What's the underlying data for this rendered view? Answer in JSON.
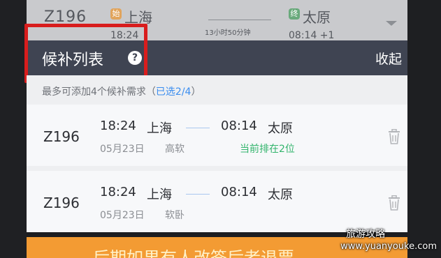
{
  "background_row": {
    "train": "Z196",
    "from_station": "上海",
    "to_station": "太原",
    "depart_time": "18:24",
    "arrive_time": "08:14 +1",
    "duration": "13小时50分钟"
  },
  "header": {
    "title": "候补列表",
    "help_icon": "?",
    "collapse_label": "收起"
  },
  "hint": {
    "prefix": "最多可添加4个候补需求（",
    "selected": "已选2/4",
    "suffix": "）"
  },
  "items": [
    {
      "train": "Z196",
      "depart_time": "18:24",
      "from_station": "上海",
      "arrive_time": "08:14",
      "to_station": "太原",
      "date": "05月23日",
      "seat": "高软",
      "status": "当前排在2位"
    },
    {
      "train": "Z196",
      "depart_time": "18:24",
      "from_station": "上海",
      "arrive_time": "08:14",
      "to_station": "太原",
      "date": "05月23日",
      "seat": "软卧",
      "status": ""
    }
  ],
  "banner": {
    "text": "后期如果有人改签后者退票"
  },
  "watermark": {
    "cn": "旅游攻略",
    "url": "www.yuanyouke.com"
  },
  "colors": {
    "header_bg": "#3f4452",
    "status_green": "#32b46c",
    "highlight_red": "#d81d1d",
    "banner_orange": "#f39b33",
    "link_blue": "#3a8df0"
  }
}
